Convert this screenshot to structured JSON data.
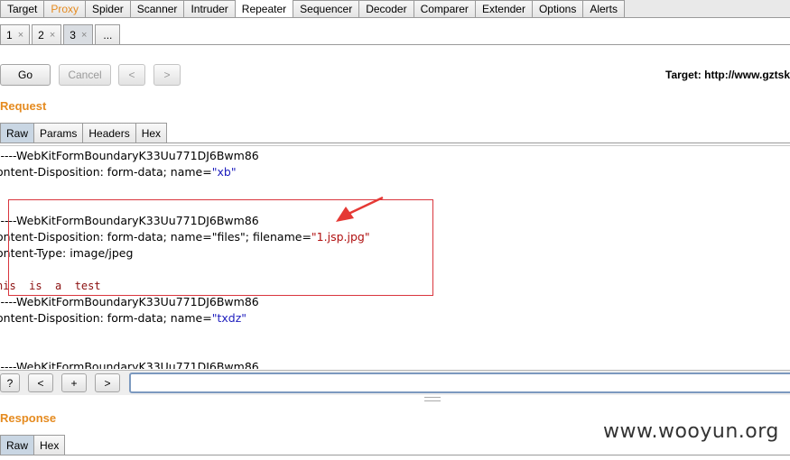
{
  "top_tabs": [
    {
      "label": "Target"
    },
    {
      "label": "Proxy"
    },
    {
      "label": "Spider"
    },
    {
      "label": "Scanner"
    },
    {
      "label": "Intruder"
    },
    {
      "label": "Repeater"
    },
    {
      "label": "Sequencer"
    },
    {
      "label": "Decoder"
    },
    {
      "label": "Comparer"
    },
    {
      "label": "Extender"
    },
    {
      "label": "Options"
    },
    {
      "label": "Alerts"
    }
  ],
  "repeater_tabs": [
    {
      "label": "1",
      "close": "×"
    },
    {
      "label": "2",
      "close": "×"
    },
    {
      "label": "3",
      "close": "×"
    },
    {
      "label": "..."
    }
  ],
  "toolbar": {
    "go_label": "Go",
    "cancel_label": "Cancel",
    "back_label": "<",
    "forward_label": ">",
    "target_text": "Target: http://www.gztsks"
  },
  "request": {
    "title": "Request",
    "tabs": [
      "Raw",
      "Params",
      "Headers",
      "Hex"
    ],
    "lines": {
      "l1": "-----WebKitFormBoundaryK33Uu771DJ6Bwm86",
      "l2_key": "ontent-Disposition: form-data; name=",
      "l2_val": "\"xb\"",
      "l3": "-----WebKitFormBoundaryK33Uu771DJ6Bwm86",
      "l4_key": "ontent-Disposition: form-data; name=\"files\"; filename=",
      "l4_val": "\"1.jsp.jpg\"",
      "l5": "ontent-Type: image/jpeg",
      "l6": "his  is  a  test",
      "l7": "-----WebKitFormBoundaryK33Uu771DJ6Bwm86",
      "l8_key": "ontent-Disposition: form-data; name=",
      "l8_val": "\"txdz\"",
      "l9": "-----WebKitFormBoundaryK33Uu771DJ6Bwm86"
    }
  },
  "search": {
    "help_label": "?",
    "prev_label": "<",
    "add_label": "+",
    "next_label": ">",
    "value": ""
  },
  "response": {
    "title": "Response",
    "tabs": [
      "Raw",
      "Hex"
    ]
  },
  "watermark": "www.wooyun.org",
  "colors": {
    "accent": "#e58b20",
    "annotation": "#d9363e"
  }
}
